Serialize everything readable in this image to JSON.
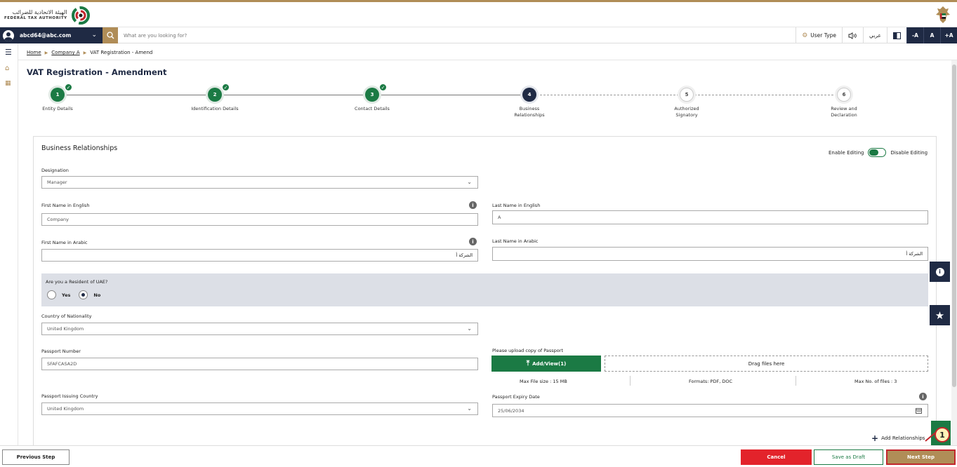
{
  "header": {
    "logo_ar": "الهيئة الاتحادية للضرائب",
    "logo_en": "FEDERAL TAX AUTHORITY",
    "emblem_icon": "uae-emblem-icon"
  },
  "navbar": {
    "user_email": "abcd64@abc.com",
    "search_placeholder": "What are you looking for?",
    "user_type": "User Type",
    "language": "عربي",
    "font_decrease": "-A",
    "font_normal": "A",
    "font_increase": "+A"
  },
  "breadcrumb": {
    "home": "Home",
    "company": "Company A",
    "current": "VAT Registration - Amend"
  },
  "page_title": "VAT Registration - Amendment",
  "steps": [
    {
      "num": "1",
      "label": "Entity Details",
      "state": "done"
    },
    {
      "num": "2",
      "label": "Identification Details",
      "state": "done"
    },
    {
      "num": "3",
      "label": "Contact Details",
      "state": "done"
    },
    {
      "num": "4",
      "label": "Business Relationships",
      "state": "active"
    },
    {
      "num": "5",
      "label": "Authorized Signatory",
      "state": "todo"
    },
    {
      "num": "6",
      "label": "Review and Declaration",
      "state": "todo"
    }
  ],
  "form": {
    "section_title": "Business Relationships",
    "enable_editing": "Enable Editing",
    "disable_editing": "Disable Editing",
    "designation_label": "Designation",
    "designation_value": "Manager",
    "first_name_en_label": "First Name in English",
    "first_name_en_value": "Company",
    "last_name_en_label": "Last Name in English",
    "last_name_en_value": "A",
    "first_name_ar_label": "First Name in Arabic",
    "first_name_ar_value": "الشركة أ",
    "last_name_ar_label": "Last Name in Arabic",
    "last_name_ar_value": "الشركة أ",
    "resident_question": "Are you a Resident of UAE?",
    "yes_label": "Yes",
    "no_label": "No",
    "resident_selected": "No",
    "nationality_label": "Country of Nationality",
    "nationality_value": "United Kingdom",
    "passport_number_label": "Passport Number",
    "passport_number_value": "SFAFCASA2D",
    "upload_label": "Please upload copy of Passport",
    "upload_button": "Add/View(1)",
    "drop_text": "Drag files here",
    "max_size": "Max File size : 15 MB",
    "formats": "Formats: PDF, DOC",
    "max_files": "Max No. of files : 3",
    "passport_country_label": "Passport Issuing Country",
    "passport_country_value": "United Kingdom",
    "passport_expiry_label": "Passport Expiry Date",
    "passport_expiry_value": "25/06/2034",
    "add_relationships": "Add Relationships"
  },
  "footer": {
    "previous": "Previous Step",
    "cancel": "Cancel",
    "save_draft": "Save as Draft",
    "next": "Next Step"
  },
  "callout_number": "1",
  "colors": {
    "navy": "#1f2a44",
    "gold": "#b08d57",
    "green": "#1b7a44",
    "red": "#e3232b"
  }
}
